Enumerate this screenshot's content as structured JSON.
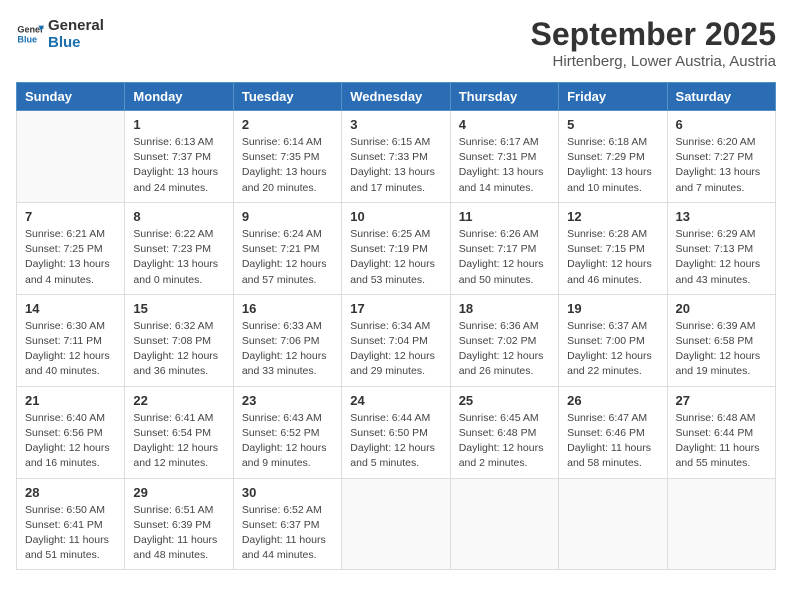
{
  "logo": {
    "line1": "General",
    "line2": "Blue"
  },
  "title": "September 2025",
  "subtitle": "Hirtenberg, Lower Austria, Austria",
  "weekdays": [
    "Sunday",
    "Monday",
    "Tuesday",
    "Wednesday",
    "Thursday",
    "Friday",
    "Saturday"
  ],
  "weeks": [
    [
      {
        "day": "",
        "info": ""
      },
      {
        "day": "1",
        "info": "Sunrise: 6:13 AM\nSunset: 7:37 PM\nDaylight: 13 hours\nand 24 minutes."
      },
      {
        "day": "2",
        "info": "Sunrise: 6:14 AM\nSunset: 7:35 PM\nDaylight: 13 hours\nand 20 minutes."
      },
      {
        "day": "3",
        "info": "Sunrise: 6:15 AM\nSunset: 7:33 PM\nDaylight: 13 hours\nand 17 minutes."
      },
      {
        "day": "4",
        "info": "Sunrise: 6:17 AM\nSunset: 7:31 PM\nDaylight: 13 hours\nand 14 minutes."
      },
      {
        "day": "5",
        "info": "Sunrise: 6:18 AM\nSunset: 7:29 PM\nDaylight: 13 hours\nand 10 minutes."
      },
      {
        "day": "6",
        "info": "Sunrise: 6:20 AM\nSunset: 7:27 PM\nDaylight: 13 hours\nand 7 minutes."
      }
    ],
    [
      {
        "day": "7",
        "info": "Sunrise: 6:21 AM\nSunset: 7:25 PM\nDaylight: 13 hours\nand 4 minutes."
      },
      {
        "day": "8",
        "info": "Sunrise: 6:22 AM\nSunset: 7:23 PM\nDaylight: 13 hours\nand 0 minutes."
      },
      {
        "day": "9",
        "info": "Sunrise: 6:24 AM\nSunset: 7:21 PM\nDaylight: 12 hours\nand 57 minutes."
      },
      {
        "day": "10",
        "info": "Sunrise: 6:25 AM\nSunset: 7:19 PM\nDaylight: 12 hours\nand 53 minutes."
      },
      {
        "day": "11",
        "info": "Sunrise: 6:26 AM\nSunset: 7:17 PM\nDaylight: 12 hours\nand 50 minutes."
      },
      {
        "day": "12",
        "info": "Sunrise: 6:28 AM\nSunset: 7:15 PM\nDaylight: 12 hours\nand 46 minutes."
      },
      {
        "day": "13",
        "info": "Sunrise: 6:29 AM\nSunset: 7:13 PM\nDaylight: 12 hours\nand 43 minutes."
      }
    ],
    [
      {
        "day": "14",
        "info": "Sunrise: 6:30 AM\nSunset: 7:11 PM\nDaylight: 12 hours\nand 40 minutes."
      },
      {
        "day": "15",
        "info": "Sunrise: 6:32 AM\nSunset: 7:08 PM\nDaylight: 12 hours\nand 36 minutes."
      },
      {
        "day": "16",
        "info": "Sunrise: 6:33 AM\nSunset: 7:06 PM\nDaylight: 12 hours\nand 33 minutes."
      },
      {
        "day": "17",
        "info": "Sunrise: 6:34 AM\nSunset: 7:04 PM\nDaylight: 12 hours\nand 29 minutes."
      },
      {
        "day": "18",
        "info": "Sunrise: 6:36 AM\nSunset: 7:02 PM\nDaylight: 12 hours\nand 26 minutes."
      },
      {
        "day": "19",
        "info": "Sunrise: 6:37 AM\nSunset: 7:00 PM\nDaylight: 12 hours\nand 22 minutes."
      },
      {
        "day": "20",
        "info": "Sunrise: 6:39 AM\nSunset: 6:58 PM\nDaylight: 12 hours\nand 19 minutes."
      }
    ],
    [
      {
        "day": "21",
        "info": "Sunrise: 6:40 AM\nSunset: 6:56 PM\nDaylight: 12 hours\nand 16 minutes."
      },
      {
        "day": "22",
        "info": "Sunrise: 6:41 AM\nSunset: 6:54 PM\nDaylight: 12 hours\nand 12 minutes."
      },
      {
        "day": "23",
        "info": "Sunrise: 6:43 AM\nSunset: 6:52 PM\nDaylight: 12 hours\nand 9 minutes."
      },
      {
        "day": "24",
        "info": "Sunrise: 6:44 AM\nSunset: 6:50 PM\nDaylight: 12 hours\nand 5 minutes."
      },
      {
        "day": "25",
        "info": "Sunrise: 6:45 AM\nSunset: 6:48 PM\nDaylight: 12 hours\nand 2 minutes."
      },
      {
        "day": "26",
        "info": "Sunrise: 6:47 AM\nSunset: 6:46 PM\nDaylight: 11 hours\nand 58 minutes."
      },
      {
        "day": "27",
        "info": "Sunrise: 6:48 AM\nSunset: 6:44 PM\nDaylight: 11 hours\nand 55 minutes."
      }
    ],
    [
      {
        "day": "28",
        "info": "Sunrise: 6:50 AM\nSunset: 6:41 PM\nDaylight: 11 hours\nand 51 minutes."
      },
      {
        "day": "29",
        "info": "Sunrise: 6:51 AM\nSunset: 6:39 PM\nDaylight: 11 hours\nand 48 minutes."
      },
      {
        "day": "30",
        "info": "Sunrise: 6:52 AM\nSunset: 6:37 PM\nDaylight: 11 hours\nand 44 minutes."
      },
      {
        "day": "",
        "info": ""
      },
      {
        "day": "",
        "info": ""
      },
      {
        "day": "",
        "info": ""
      },
      {
        "day": "",
        "info": ""
      }
    ]
  ]
}
